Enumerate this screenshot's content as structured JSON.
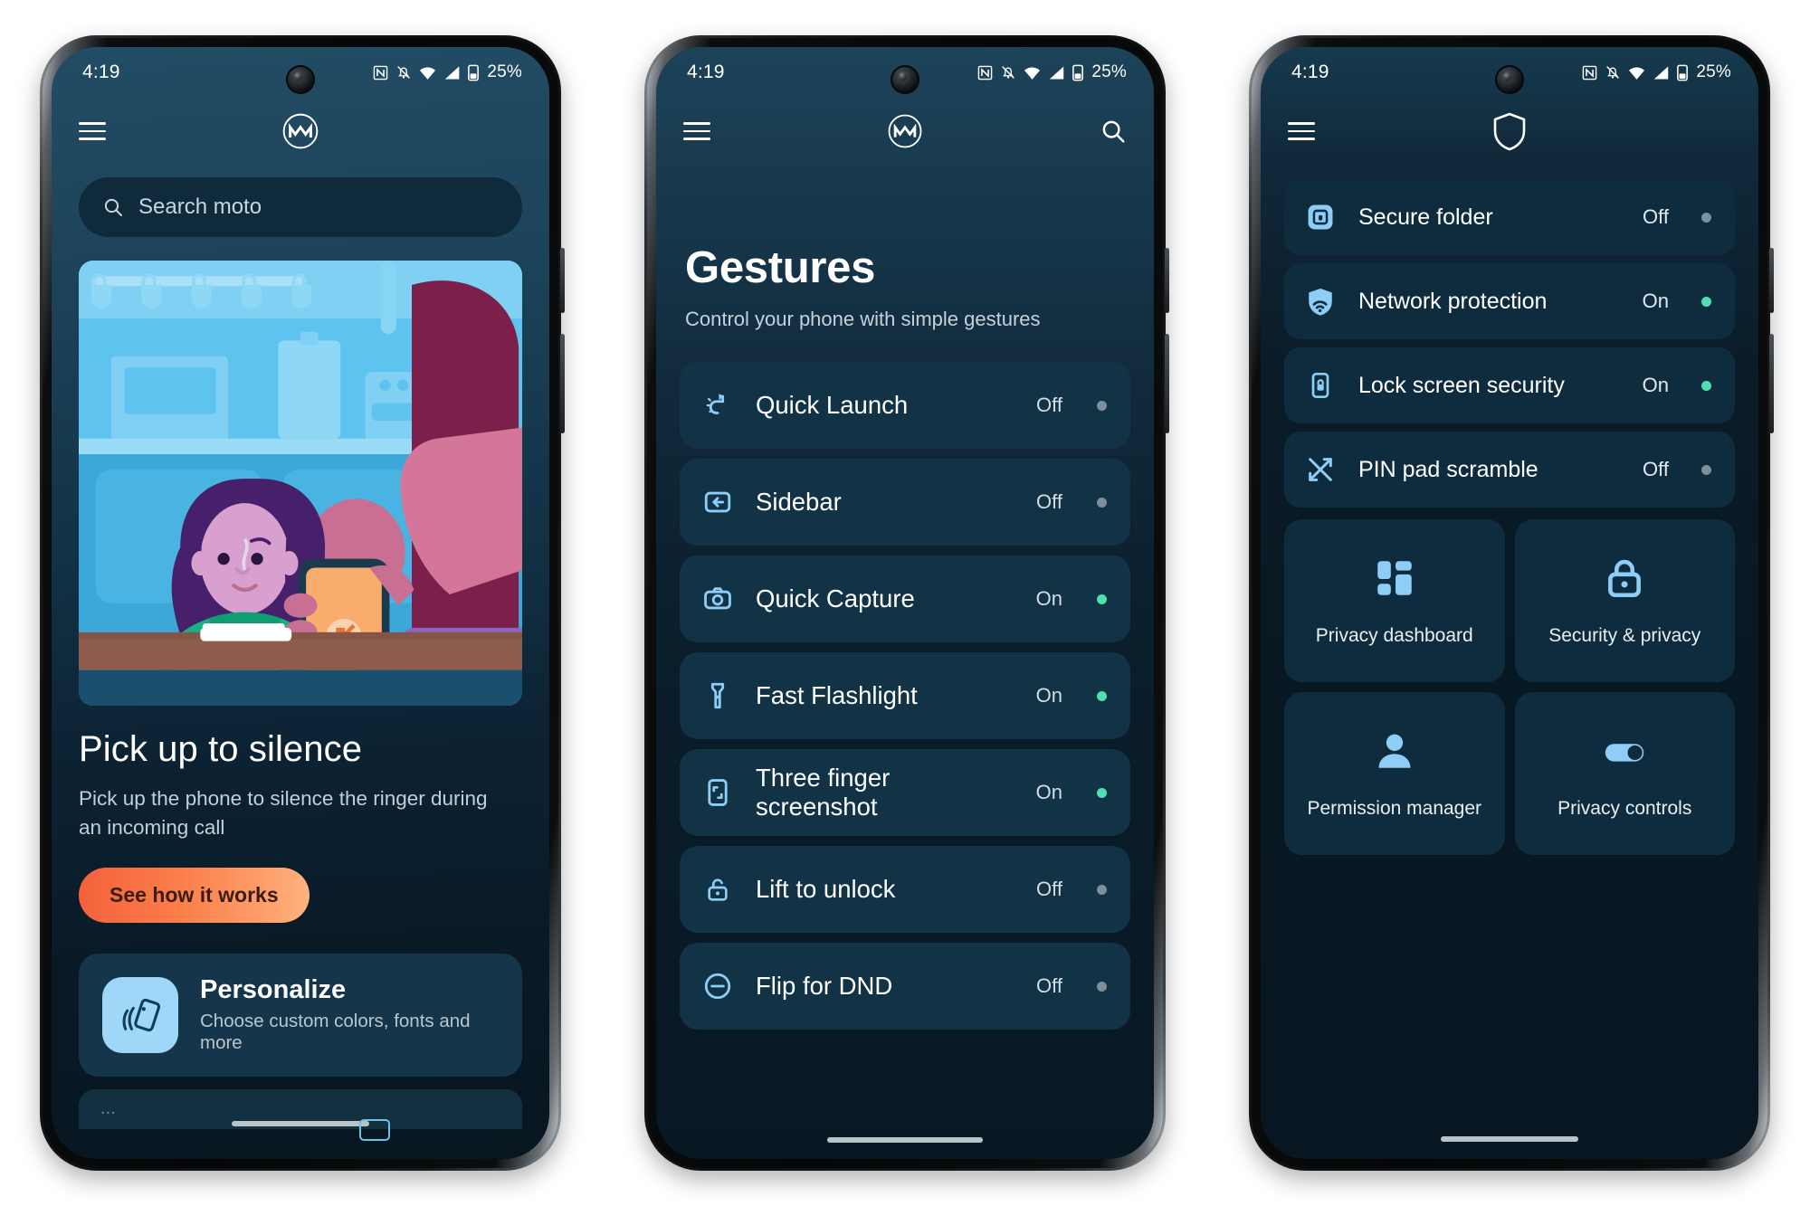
{
  "status_bar": {
    "time": "4:19",
    "battery_text": "25%",
    "icons": [
      "nfc-icon",
      "notifications-muted-icon",
      "wifi-icon",
      "signal-icon",
      "battery-icon"
    ]
  },
  "phone1": {
    "app_bar": {
      "menu": "menu-icon",
      "logo": "motorola-logo-icon"
    },
    "search": {
      "placeholder": "Search moto",
      "icon": "search-icon",
      "value": ""
    },
    "hero": {
      "illustration": "two-people-at-cafe-illustration",
      "title": "Pick up to silence",
      "description": "Pick up the phone to silence the ringer during an incoming call",
      "cta_label": "See how it works"
    },
    "personalize_card": {
      "icon": "personalize-icon",
      "title": "Personalize",
      "subtitle": "Choose custom colors, fonts and more"
    },
    "peek_text": "..."
  },
  "phone2": {
    "app_bar": {
      "menu": "menu-icon",
      "logo": "motorola-logo-icon",
      "search": "search-icon"
    },
    "title": "Gestures",
    "subtitle": "Control your phone with simple gestures",
    "items": [
      {
        "label": "Quick Launch",
        "state": "Off",
        "on": false,
        "icon": "quick-launch-icon"
      },
      {
        "label": "Sidebar",
        "state": "Off",
        "on": false,
        "icon": "sidebar-icon"
      },
      {
        "label": "Quick Capture",
        "state": "On",
        "on": true,
        "icon": "camera-icon"
      },
      {
        "label": "Fast Flashlight",
        "state": "On",
        "on": true,
        "icon": "flashlight-icon"
      },
      {
        "label": "Three finger screenshot",
        "state": "On",
        "on": true,
        "icon": "screenshot-icon"
      },
      {
        "label": "Lift to unlock",
        "state": "Off",
        "on": false,
        "icon": "unlock-icon"
      },
      {
        "label": "Flip for DND",
        "state": "Off",
        "on": false,
        "icon": "do-not-disturb-icon"
      }
    ]
  },
  "phone3": {
    "app_bar": {
      "menu": "menu-icon",
      "logo": "shield-icon"
    },
    "items": [
      {
        "label": "Secure folder",
        "state": "Off",
        "on": false,
        "icon": "secure-folder-icon"
      },
      {
        "label": "Network protection",
        "state": "On",
        "on": true,
        "icon": "network-protection-icon"
      },
      {
        "label": "Lock screen security",
        "state": "On",
        "on": true,
        "icon": "lock-screen-icon"
      },
      {
        "label": "PIN pad scramble",
        "state": "Off",
        "on": false,
        "icon": "shuffle-icon"
      }
    ],
    "tiles": [
      {
        "label": "Privacy dashboard",
        "icon": "dashboard-grid-icon"
      },
      {
        "label": "Security & privacy",
        "icon": "padlock-icon"
      },
      {
        "label": "Permission manager",
        "icon": "person-icon"
      },
      {
        "label": "Privacy controls",
        "icon": "toggle-switch-icon"
      }
    ]
  },
  "colors": {
    "accent_blue": "#8ecdf5",
    "state_on": "#4ee0b0",
    "state_off": "#7d8f99",
    "cta_gradient_start": "#f4613c",
    "cta_gradient_end": "#ffb27e",
    "card_bg": "#123246"
  }
}
